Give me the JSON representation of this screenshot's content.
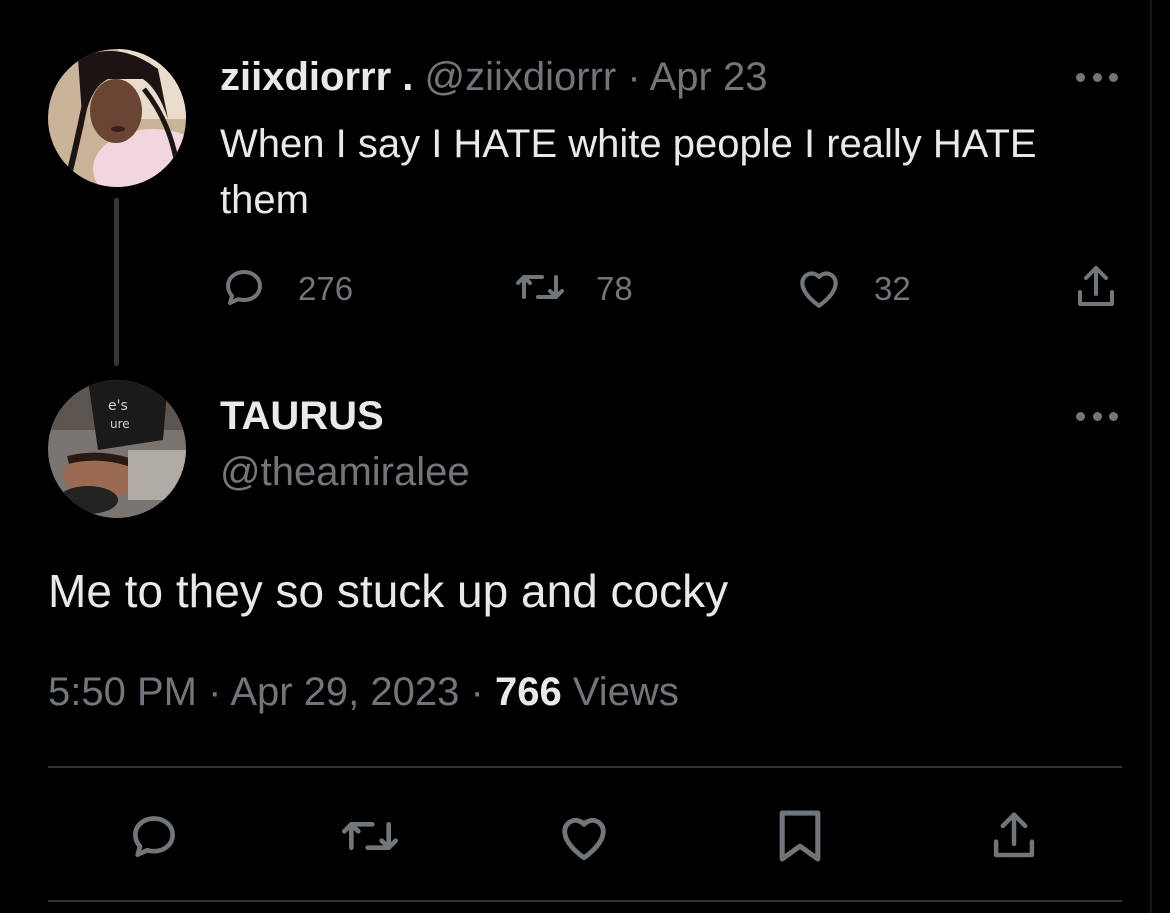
{
  "colors": {
    "background": "#000000",
    "primary_text": "#e7e9ea",
    "secondary_text": "#71767b",
    "divider": "#2f3336",
    "thread_line": "#333639"
  },
  "parent_tweet": {
    "avatar_icon": "profile-photo",
    "display_name": "ziixdiorrr .",
    "handle": "@ziixdiorrr",
    "separator": "·",
    "date": "Apr 23",
    "more_icon": "more-horizontal-icon",
    "text": "When I say I HATE white people I really HATE them",
    "actions": {
      "replies": {
        "icon": "reply-icon",
        "count": "276"
      },
      "retweets": {
        "icon": "retweet-icon",
        "count": "78"
      },
      "likes": {
        "icon": "heart-icon",
        "count": "32"
      },
      "share": {
        "icon": "share-icon"
      }
    }
  },
  "reply_tweet": {
    "avatar_icon": "profile-photo",
    "display_name": "TAURUS",
    "handle": "@theamiralee",
    "more_icon": "more-horizontal-icon",
    "text": "Me to they so stuck up and cocky",
    "time": "5:50 PM",
    "separator": "·",
    "date": "Apr 29, 2023",
    "views_count": "766",
    "views_label": "Views"
  },
  "bottom_actions": [
    {
      "icon": "reply-icon"
    },
    {
      "icon": "retweet-icon"
    },
    {
      "icon": "heart-icon"
    },
    {
      "icon": "bookmark-icon"
    },
    {
      "icon": "share-icon"
    }
  ]
}
